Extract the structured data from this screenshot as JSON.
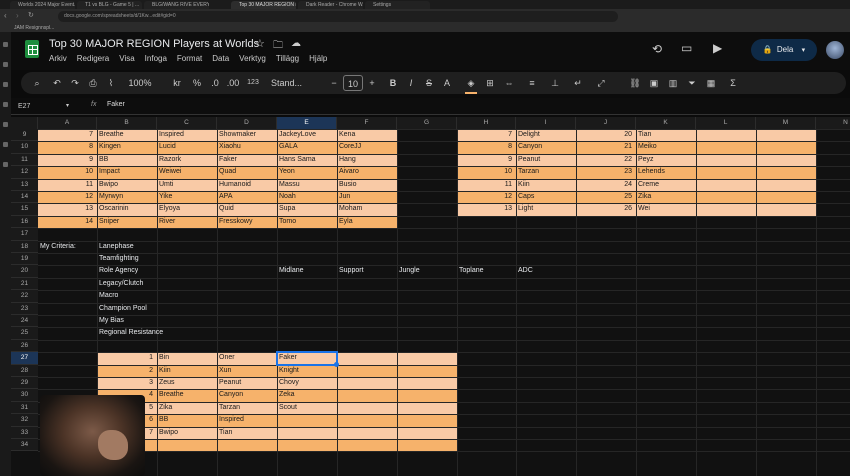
{
  "browser": {
    "tabs": [
      "Worlds 2024 Major Event...",
      "T1 vs BLG - Game 5 | ...",
      "BLG/WANG RIVE EVERY Worl...",
      "Top 30 MAJOR REGION P...",
      "Dark Reader - Chrome W...",
      "Settings"
    ],
    "active_tab": 3,
    "url": "docs.google.com/spreadsheets/d/1Kw...edit#gid=0",
    "bookmark": "JAM Resignnspl..."
  },
  "doc": {
    "title": "Top 30 MAJOR REGION Players at Worlds",
    "menu": [
      "Arkiv",
      "Redigera",
      "Visa",
      "Infoga",
      "Format",
      "Data",
      "Verktyg",
      "Tillägg",
      "Hjälp"
    ],
    "share_label": "Dela"
  },
  "toolbar": {
    "zoom": "100%",
    "currency": "kr",
    "percent": "%",
    "dec_dec": ".0",
    "dec_inc": ".00",
    "num_format": "123",
    "font": "Stand...",
    "font_size": "10",
    "bold": "B",
    "italic": "I",
    "strike": "S",
    "text_color": "A",
    "sigma": "Σ",
    "minus": "−",
    "plus": "+"
  },
  "formula_bar": {
    "cell_ref": "E27",
    "fx": "fx",
    "value": "Faker"
  },
  "grid": {
    "columns": [
      "A",
      "B",
      "C",
      "D",
      "E",
      "F",
      "G",
      "H",
      "I",
      "J",
      "K",
      "L",
      "M",
      "N"
    ],
    "rows": [
      "9",
      "10",
      "11",
      "12",
      "13",
      "14",
      "15",
      "16",
      "17",
      "18",
      "19",
      "20",
      "21",
      "22",
      "23",
      "24",
      "25",
      "26",
      "27",
      "28",
      "29",
      "30",
      "31",
      "32",
      "33",
      "34"
    ],
    "selected_col": "E",
    "selected_row": "27",
    "table1": [
      [
        "7",
        "Breathe",
        "Inspired",
        "Showmaker",
        "JackeyLove",
        "Kena"
      ],
      [
        "8",
        "Kingen",
        "Lucid",
        "Xiaohu",
        "GALA",
        "CoreJJ"
      ],
      [
        "9",
        "BB",
        "Razork",
        "Faker",
        "Hans Sama",
        "Hang"
      ],
      [
        "10",
        "Impact",
        "Weiwei",
        "Quad",
        "Yeon",
        "Aivaro"
      ],
      [
        "11",
        "Bwipo",
        "Umti",
        "Humanoid",
        "Massu",
        "Busio"
      ],
      [
        "12",
        "Myrwyn",
        "Yike",
        "APA",
        "Noah",
        "Jun"
      ],
      [
        "13",
        "Oscarinin",
        "Elyoya",
        "Quid",
        "Supa",
        "Moham"
      ],
      [
        "14",
        "Sniper",
        "River",
        "Fresskowy",
        "Tomo",
        "Eyla"
      ]
    ],
    "table2": [
      [
        "7",
        "Delight",
        "20",
        "Tian"
      ],
      [
        "8",
        "Canyon",
        "21",
        "Meiko"
      ],
      [
        "9",
        "Peanut",
        "22",
        "Peyz"
      ],
      [
        "10",
        "Tarzan",
        "23",
        "Lehends"
      ],
      [
        "11",
        "Kiin",
        "24",
        "Creme"
      ],
      [
        "12",
        "Caps",
        "25",
        "Zika"
      ],
      [
        "13",
        "Light",
        "26",
        "Wei"
      ]
    ],
    "criteria_label": "My Criteria:",
    "criteria": [
      "Lanephase",
      "Teamfighting",
      "Role Agency",
      "Legacy/Clutch",
      "Macro",
      "Champion Pool",
      "My Bias",
      "Regional Resistance"
    ],
    "role_headers": [
      "Midlane",
      "Support",
      "Jungle",
      "Toplane",
      "ADC"
    ],
    "ranking": [
      [
        "1",
        "Bin",
        "Oner",
        "Faker"
      ],
      [
        "2",
        "Kiin",
        "Xun",
        "Knight"
      ],
      [
        "3",
        "Zeus",
        "Peanut",
        "Chovy"
      ],
      [
        "4",
        "Breathe",
        "Canyon",
        "Zeka"
      ],
      [
        "5",
        "Zika",
        "Tarzan",
        "Scout"
      ],
      [
        "6",
        "BB",
        "Inspired",
        ""
      ],
      [
        "7",
        "Bwipo",
        "Tian",
        ""
      ]
    ]
  },
  "colors": {
    "band_a": "#f9caa6",
    "band_b": "#f6b26b",
    "accent": "#1a73e8",
    "share_bg": "#0e2a47"
  }
}
